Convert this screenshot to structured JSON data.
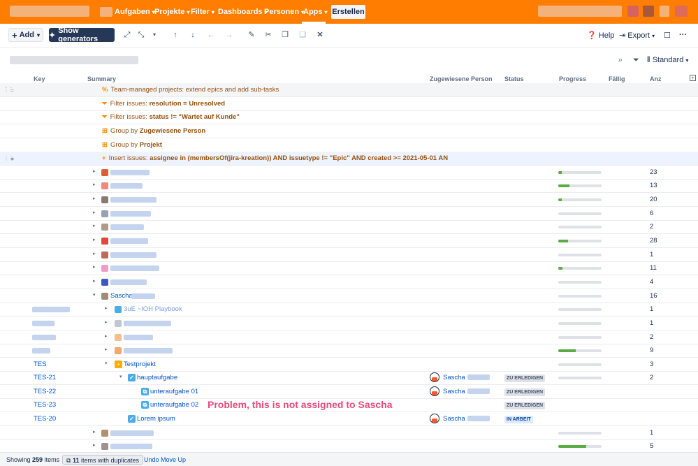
{
  "topnav": {
    "items": [
      {
        "label": "Aufgaben"
      },
      {
        "label": "Projekte"
      },
      {
        "label": "Filter"
      },
      {
        "label": "Dashboards"
      },
      {
        "label": "Personen"
      },
      {
        "label": "Apps"
      }
    ],
    "create_label": "Erstellen",
    "color": "#ff7d00"
  },
  "toolbar": {
    "add_label": "Add",
    "generators_label": "Show generators",
    "help_label": "Help",
    "export_label": "Export"
  },
  "view": {
    "standard_label": "Standard"
  },
  "columns": {
    "key": "Key",
    "summary": "Summary",
    "assignee": "Zugewiesene Person",
    "status": "Status",
    "progress": "Progress",
    "due": "Fällig",
    "count": "Anz"
  },
  "generators": [
    {
      "icon": "link-icon",
      "prefix": "Team-managed projects: extend epics and add sub-tasks",
      "bold": ""
    },
    {
      "icon": "filter-icon",
      "prefix": "Filter issues: ",
      "bold": "resolution = Unresolved"
    },
    {
      "icon": "filter-icon",
      "prefix": "Filter issues: ",
      "bold": "status != \"Wartet auf Kunde\""
    },
    {
      "icon": "group-icon",
      "prefix": "Group by ",
      "bold": "Zugewiesene Person"
    },
    {
      "icon": "group-icon",
      "prefix": "Group by ",
      "bold": "Projekt"
    },
    {
      "icon": "plus-icon",
      "prefix": "Insert issues: ",
      "bold": "assignee in (membersOf(jira-kreation)) AND issuetype != \"Epic\" AND created >= 2021-05-01 AN"
    }
  ],
  "groups": [
    {
      "count": "23",
      "progress": 0.08
    },
    {
      "count": "13",
      "progress": 0.25
    },
    {
      "count": "20",
      "progress": 0.08
    },
    {
      "count": "6",
      "progress": 0
    },
    {
      "count": "2",
      "progress": 0
    },
    {
      "count": "28",
      "progress": 0.22
    },
    {
      "count": "1",
      "progress": 0
    },
    {
      "count": "11",
      "progress": 0.1
    },
    {
      "count": "4",
      "progress": 0
    }
  ],
  "sascha_group": {
    "label": "Sascha",
    "count": "16",
    "progress": 0
  },
  "sub_groups": [
    {
      "label": "3uE ~IOH Playbook",
      "count": "1",
      "progress": 0
    },
    {
      "count": "1",
      "progress": 0
    },
    {
      "count": "2",
      "progress": 0
    },
    {
      "count": "9",
      "progress": 0.4
    }
  ],
  "tes_rows": [
    {
      "key": "TES",
      "summary": "Testprojekt",
      "count": "3",
      "progress": 0
    },
    {
      "key": "TES-21",
      "summary": "hauptaufgabe",
      "assignee": "Sascha",
      "status": "ZU ERLEDIGEN",
      "count": "2",
      "progress": 0
    },
    {
      "key": "TES-22",
      "summary": "unteraufgabe 01",
      "assignee": "Sascha",
      "status": "ZU ERLEDIGEN"
    },
    {
      "key": "TES-23",
      "summary": "unteraufgabe 02",
      "status": "ZU ERLEDIGEN"
    },
    {
      "key": "TES-20",
      "summary": "Lorem ipsum",
      "assignee": "Sascha",
      "status": "IN ARBEIT"
    }
  ],
  "tail_groups": [
    {
      "count": "1",
      "progress": 0
    },
    {
      "count": "5",
      "progress": 0.65
    }
  ],
  "annotation": "Problem, this is not assigned to Sascha",
  "footer": {
    "showing_prefix": "Showing",
    "showing_count": "259",
    "showing_suffix": "items",
    "duplicates_count": "11",
    "duplicates_label": "items with duplicates",
    "undo_label": "Undo Move Up"
  }
}
